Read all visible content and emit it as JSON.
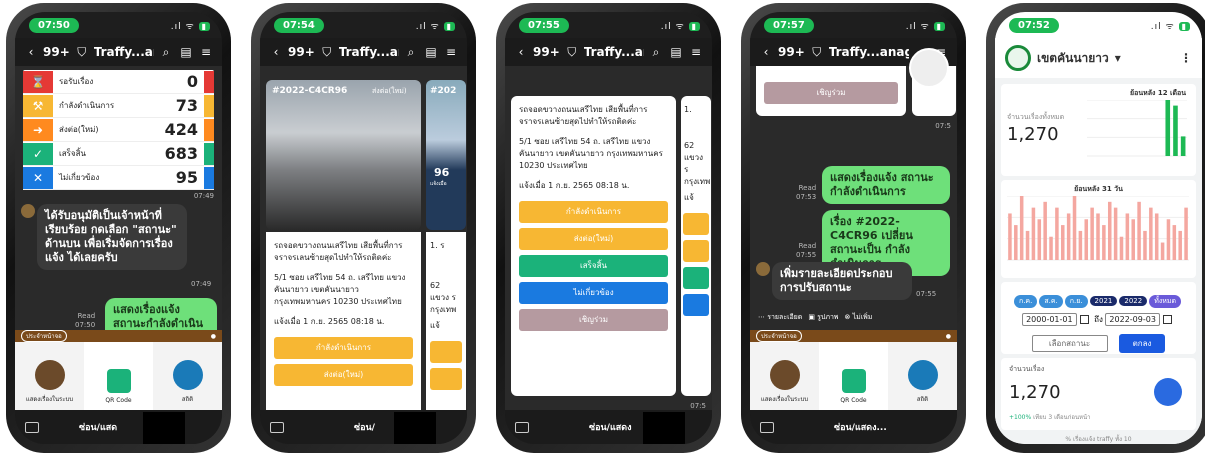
{
  "phone1": {
    "time": "07:50",
    "nav": {
      "count": "99+",
      "title": "Traffy...anager"
    },
    "stats": [
      {
        "label": "รอรับเรื่อง",
        "value": "0",
        "color": "#e53935",
        "icon": "hourglass-icon"
      },
      {
        "label": "กำลังดำเนินการ",
        "value": "73",
        "color": "#f7b733",
        "icon": "worker-icon"
      },
      {
        "label": "ส่งต่อ(ใหม่)",
        "value": "424",
        "color": "#ff8a1f",
        "icon": "forward-icon"
      },
      {
        "label": "เสร็จสิ้น",
        "value": "683",
        "color": "#1bb27a",
        "icon": "check-icon"
      },
      {
        "label": "ไม่เกี่ยวข้อง",
        "value": "95",
        "color": "#1a7ae0",
        "icon": "x-icon"
      }
    ],
    "stats_time": "07:49",
    "msg_in": "ได้รับอนุมัติเป็นเจ้าหน้าที่เรียบร้อย กดเลือก \"สถานะ\" ด้านบน เพื่อเริ่มจัดการเรื่องแจ้ง ได้เลยครับ",
    "msg_in_time": "07:49",
    "msg_out": "แสดงเรื่องแจ้ง สถานะกำลังดำเนินการ",
    "read": "Read",
    "msg_out_time": "07:50",
    "rm_label": "ประจำหน้าจอ",
    "menu": [
      "แสดงเรื่องในระบบ",
      "QR Code",
      "สถิติ"
    ],
    "bottom": "ซ่อน/แสด"
  },
  "phone2": {
    "time": "07:54",
    "nav": {
      "count": "99+",
      "title": "Traffy...anager"
    },
    "case_id": "#2022-C4CR96",
    "case_status": "ส่งต่อ(ใหม่)",
    "peek_id": "#202",
    "peek_num": "96",
    "peek_sub": "แจ้งเมื่อ",
    "desc": "รถจอดขวางถนนเสรีไทย เสียพื้นที่การจราจรเลนซ้ายสุดไปทำให้รถติดค่ะ",
    "peek_desc": "1. ร",
    "address": "5/1 ซอย เสรีไทย 54 ถ. เสรีไทย แขวง คันนายาว เขตคันนายาว กรุงเทพมหานคร 10230 ประเทศไทย",
    "peek_addr": "62",
    "peek_addr2": "แขวง ร",
    "peek_addr3": "กรุงเทพ",
    "reported": "แจ้งเมื่อ 1 ก.ย. 2565 08:18 น.",
    "peek_reported": "แจ้",
    "buttons": [
      "กำลังดำเนินการ",
      "ส่งต่อ(ใหม่)"
    ],
    "bottom": "ซ่อน/"
  },
  "phone3": {
    "time": "07:55",
    "nav": {
      "count": "99+",
      "title": "Traffy...anager"
    },
    "desc": "รถจอดขวางถนนเสรีไทย เสียพื้นที่การจราจรเลนซ้ายสุดไปทำให้รถติดค่ะ",
    "peek_desc": "1.",
    "address": "5/1 ซอย เสรีไทย 54 ถ. เสรีไทย แขวง คันนายาว เขตคันนายาว กรุงเทพมหานคร 10230 ประเทศไทย",
    "peek_addr": "62",
    "peek_addr2": "แขวง ร",
    "peek_addr3": "กรุงเทพ",
    "reported": "แจ้งเมื่อ 1 ก.ย. 2565 08:18 น.",
    "peek_reported": "แจ้",
    "buttons": [
      "กำลังดำเนินการ",
      "ส่งต่อ(ใหม่)",
      "เสร็จสิ้น",
      "ไม่เกี่ยวข้อง",
      "เชิญร่วม"
    ],
    "msg_time": "07:5",
    "bottom": "ซ่อน/แสดง"
  },
  "phone4": {
    "time": "07:57",
    "nav": {
      "count": "99+",
      "title": "Traffy...anager"
    },
    "top_button": "เชิญร่วม",
    "msg_out1": "แสดงเรื่องแจ้ง สถานะกำลังดำเนินการ",
    "read1": "Read",
    "time1": "07:53",
    "msg_out2": "เรื่อง #2022-C4CR96 เปลี่ยนสถานะเป็น กำลังดำเนินการ",
    "read2": "Read",
    "time2": "07:55",
    "msg_in": "เพิ่มรายละเอียดประกอบการปรับสถานะ",
    "msg_in_time": "07:55",
    "peek_time": "07:5",
    "quick": [
      "รายละเอียด",
      "รูปภาพ",
      "ไม่เพิ่ม"
    ],
    "rm_label": "ประจำหน้าจอ",
    "menu": [
      "แสดงเรื่องในระบบ",
      "QR Code",
      "สถิติ"
    ],
    "bottom": "ซ่อน/แสดง..."
  },
  "phone5": {
    "time": "07:52",
    "district": "เขตคันนายาว",
    "chart1_title": "ย้อนหลัง 12 เดือน",
    "total_label": "จำนวนเรื่องทั้งหมด",
    "total": "1,270",
    "chart2_title": "ย้อนหลัง 31 วัน",
    "filter_pills": [
      "ก.ค.",
      "ส.ค.",
      "ก.ย.",
      "2021",
      "2022",
      "ทั้งหมด"
    ],
    "date_from": "2000-01-01",
    "to_label": "ถึง",
    "date_to": "2022-09-03",
    "status_placeholder": "เลือกสถานะ",
    "ok": "ตกลง",
    "count_label": "จำนวนเรื่อง",
    "count": "1,270",
    "growth": "+100%",
    "growth_note": "เทียบ 3 เดือนก่อนหน้า",
    "footer": "% เรื่องแจ้ง traffy ทั้ง 10"
  },
  "chart_data": [
    {
      "type": "bar",
      "values": [
        0,
        0,
        0,
        0,
        0,
        0,
        0,
        0,
        0,
        0,
        1,
        0.9,
        0.35
      ],
      "color": "#1db954"
    },
    {
      "type": "bar",
      "values": [
        8,
        6,
        11,
        5,
        9,
        7,
        10,
        4,
        9,
        6,
        8,
        11,
        5,
        7,
        9,
        8,
        6,
        10,
        9,
        4,
        8,
        7,
        10,
        5,
        9,
        8,
        3,
        7,
        6,
        5,
        9
      ],
      "color": "#f4a7a0"
    }
  ]
}
